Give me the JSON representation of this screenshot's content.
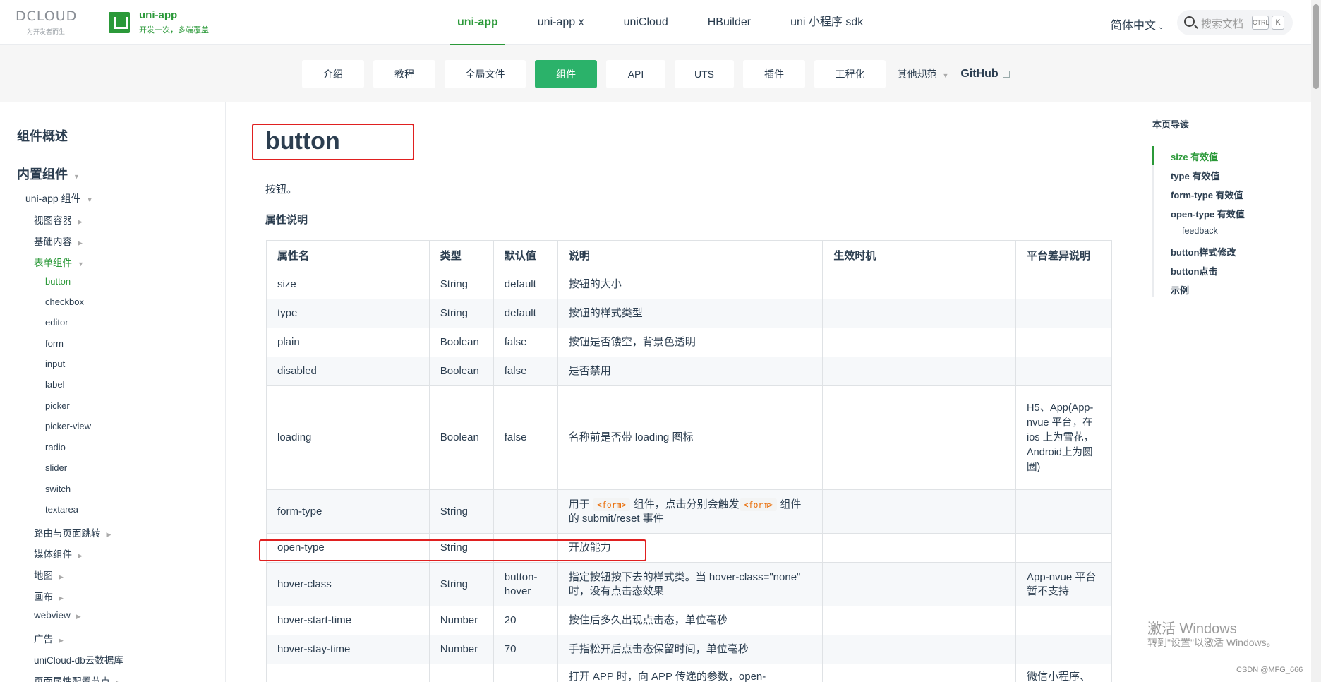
{
  "header": {
    "dcloud_word": "DCLOUD",
    "dcloud_sub": "为开发者而生",
    "app_name": "uni-app",
    "app_slogan": "开发一次，多端覆盖",
    "nav": [
      "uni-app",
      "uni-app x",
      "uniCloud",
      "HBuilder",
      "uni 小程序 sdk"
    ],
    "lang": "简体中文",
    "search_placeholder": "搜索文档",
    "kbd_ctrl": "CTRL",
    "kbd_k": "K"
  },
  "subnav": {
    "items": [
      "介绍",
      "教程",
      "全局文件",
      "组件",
      "API",
      "UTS",
      "插件",
      "工程化",
      "其他规范",
      "GitHub"
    ]
  },
  "sidebar": {
    "items": [
      "组件概述",
      "内置组件",
      "uni-app 组件",
      "视图容器",
      "基础内容",
      "表单组件",
      "button",
      "checkbox",
      "editor",
      "form",
      "input",
      "label",
      "picker",
      "picker-view",
      "radio",
      "slider",
      "switch",
      "textarea",
      "路由与页面跳转",
      "媒体组件",
      "地图",
      "画布",
      "webview",
      "广告",
      "uniCloud-db云数据库",
      "页面属性配置节点"
    ]
  },
  "main": {
    "title": "button",
    "intro": "按钮。",
    "section_title": "属性说明",
    "table": {
      "headers": [
        "属性名",
        "类型",
        "默认值",
        "说明",
        "生效时机",
        "平台差异说明"
      ],
      "rows": [
        {
          "name": "size",
          "type": "String",
          "default": "default",
          "desc": "按钮的大小",
          "timing": "",
          "platform": ""
        },
        {
          "name": "type",
          "type": "String",
          "default": "default",
          "desc": "按钮的样式类型",
          "timing": "",
          "platform": ""
        },
        {
          "name": "plain",
          "type": "Boolean",
          "default": "false",
          "desc": "按钮是否镂空，背景色透明",
          "timing": "",
          "platform": ""
        },
        {
          "name": "disabled",
          "type": "Boolean",
          "default": "false",
          "desc": "是否禁用",
          "timing": "",
          "platform": ""
        },
        {
          "name": "loading",
          "type": "Boolean",
          "default": "false",
          "desc": "名称前是否带 loading 图标",
          "timing": "",
          "platform": "H5、App(App-nvue 平台，在 ios 上为雪花，Android上为圆圈)"
        },
        {
          "name": "form-type",
          "type": "String",
          "default": "",
          "desc_pre": "用于",
          "desc_code1": "<form>",
          "desc_mid": "组件，点击分别会触发",
          "desc_code2": "<form>",
          "desc_post": "组件的 submit/reset 事件",
          "timing": "",
          "platform": ""
        },
        {
          "name": "open-type",
          "type": "String",
          "default": "",
          "desc": "开放能力",
          "timing": "",
          "platform": ""
        },
        {
          "name": "hover-class",
          "type": "String",
          "default": "button-hover",
          "desc": "指定按钮按下去的样式类。当 hover-class=\"none\" 时，没有点击态效果",
          "timing": "",
          "platform": "App-nvue 平台暂不支持"
        },
        {
          "name": "hover-start-time",
          "type": "Number",
          "default": "20",
          "desc": "按住后多久出现点击态，单位毫秒",
          "timing": "",
          "platform": ""
        },
        {
          "name": "hover-stay-time",
          "type": "Number",
          "default": "70",
          "desc": "手指松开后点击态保留时间，单位毫秒",
          "timing": "",
          "platform": ""
        },
        {
          "name": "",
          "type": "",
          "default": "",
          "desc": "打开 APP 时，向 APP 传递的参数，open-",
          "timing": "",
          "platform": "微信小程序、"
        }
      ]
    }
  },
  "toc": {
    "title": "本页导读",
    "items": [
      "size 有效值",
      "type 有效值",
      "form-type 有效值",
      "open-type 有效值",
      "feedback",
      "button样式修改",
      "button点击",
      "示例"
    ]
  },
  "overlay": {
    "watermark_line1": "激活 Windows",
    "watermark_line2": "转到\"设置\"以激活 Windows。",
    "csdn": "CSDN @MFG_666"
  },
  "colors": {
    "brand_green": "#2b9939",
    "active_button": "#2bb26a",
    "annotation_red": "#e02020"
  }
}
